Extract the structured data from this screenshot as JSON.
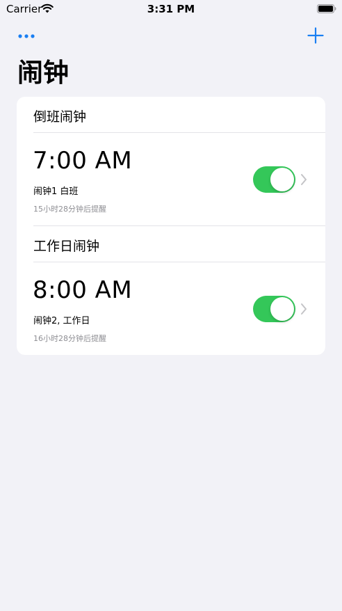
{
  "status_bar": {
    "carrier": "Carrier",
    "time": "3:31 PM"
  },
  "nav": {
    "more_icon": "ellipsis-icon",
    "add_icon": "plus-icon"
  },
  "page": {
    "title": "闹钟"
  },
  "colors": {
    "accent": "#1a7ff2",
    "toggle_on": "#34c759",
    "background": "#f2f2f7"
  },
  "sections": [
    {
      "title": "倒班闹钟",
      "alarm": {
        "time": "7:00 AM",
        "label": "闹钟1 白班",
        "countdown": "15小时28分钟后提醒",
        "enabled": true
      }
    },
    {
      "title": "工作日闹钟",
      "alarm": {
        "time": "8:00 AM",
        "label": "闹钟2, 工作日",
        "countdown": "16小时28分钟后提醒",
        "enabled": true
      }
    }
  ]
}
